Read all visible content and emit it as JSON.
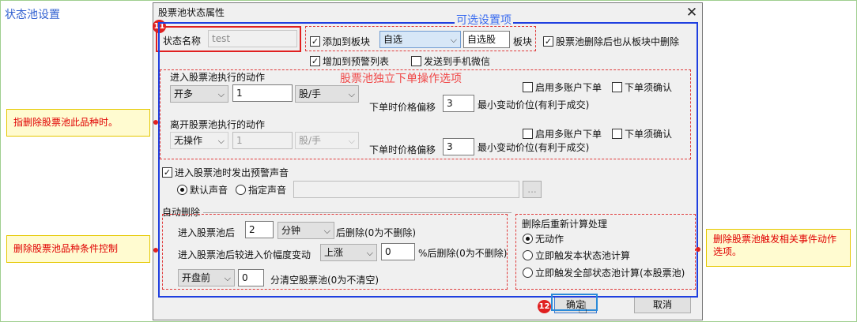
{
  "page": {
    "title": "状态池设置"
  },
  "dialog": {
    "title": "股票池状态属性",
    "close_glyph": "✕",
    "name_label": "状态名称",
    "name_value": "test",
    "add_to_block": "添加到板块",
    "block_select": "自选",
    "block_name": "自选股",
    "block_label": "板块",
    "delete_from_block": "股票池删除后也从板块中删除",
    "add_to_alert_list": "增加到预警列表",
    "send_wechat": "发送到手机微信",
    "enter": {
      "title": "进入股票池执行的动作",
      "action": "开多",
      "qty": "1",
      "unit": "股/手",
      "multi_account": "启用多账户下单",
      "confirm": "下单须确认",
      "price_offset_label": "下单时价格偏移",
      "price_offset": "3",
      "tick_hint": "最小变动价位(有利于成交)"
    },
    "leave": {
      "title": "离开股票池执行的动作",
      "action": "无操作",
      "qty": "1",
      "unit": "股/手",
      "multi_account": "启用多账户下单",
      "confirm": "下单须确认",
      "price_offset_label": "下单时价格偏移",
      "price_offset": "3",
      "tick_hint": "最小变动价位(有利于成交)"
    },
    "sound_alert": "进入股票池时发出预警声音",
    "default_sound": "默认声音",
    "custom_sound": "指定声音",
    "browse": "...",
    "auto_delete": {
      "title": "自动删除",
      "after_enter_label": "进入股票池后",
      "after_enter_value": "2",
      "after_enter_unit": "分钟",
      "after_enter_suffix": "后删除(0为不删除)",
      "change_label": "进入股票池后较进入价幅度变动",
      "change_dir": "上涨",
      "change_value": "0",
      "change_suffix": "%后删除(0为不删除)",
      "clear_time": "开盘前",
      "clear_value": "0",
      "clear_suffix": "分清空股票池(0为不清空)"
    },
    "recalc": {
      "title": "删除后重新计算处理",
      "opt_none": "无动作",
      "opt_this": "立即触发本状态池计算",
      "opt_all": "立即触发全部状态池计算(本股票池)"
    },
    "ok": "确定",
    "cancel": "取消"
  },
  "annotations": {
    "optional_settings": "可选设置项",
    "independent_order": "股票池独立下单操作选项",
    "note_delete_variety": "指删除股票池此品种时。",
    "note_condition": "删除股票池品种条件控制",
    "note_trigger": "删除股票池触发相关事件动作选项。",
    "badge_11": "11",
    "badge_12": "12"
  }
}
